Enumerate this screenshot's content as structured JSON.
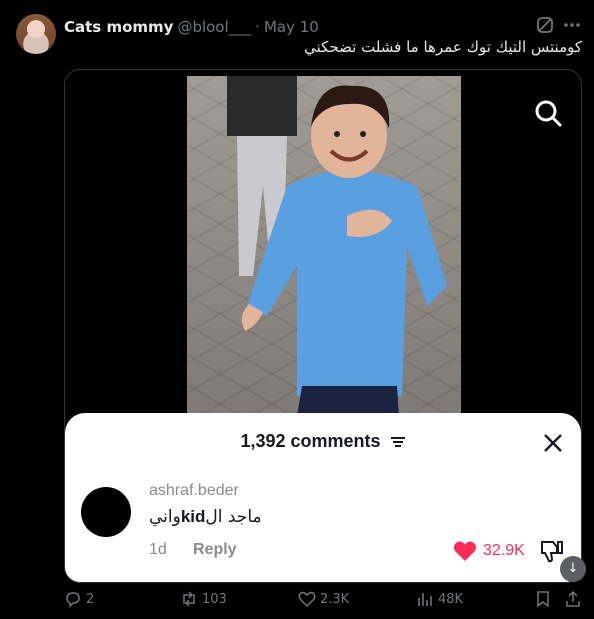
{
  "tweet": {
    "author_name": "Cats mommy",
    "handle": "@blool___",
    "separator": "·",
    "date": "May 10",
    "text": "كومنتس التيك توك عمرها ما فشلت تضحكني"
  },
  "icons": {
    "grok": "grok-icon",
    "more": "more-icon",
    "search": "search-icon",
    "close": "close-icon",
    "filter": "filter-icon",
    "heart": "heart-icon",
    "dislike": "dislike-icon",
    "download": "download-icon"
  },
  "comments_sheet": {
    "title": "1,392 comments",
    "comment": {
      "username": "ashraf.beder",
      "text_before": "ماجد ال",
      "text_latin": "kid",
      "text_after": "واني",
      "age": "1d",
      "reply_label": "Reply",
      "likes": "32.9K"
    }
  },
  "actions": {
    "replies": "2",
    "reposts": "103",
    "likes": "2.3K",
    "views": "48K"
  },
  "colors": {
    "background": "#000000",
    "muted": "#71767b",
    "tiktok_red": "#fe2c55",
    "shirt_blue": "#5aa0e0"
  }
}
